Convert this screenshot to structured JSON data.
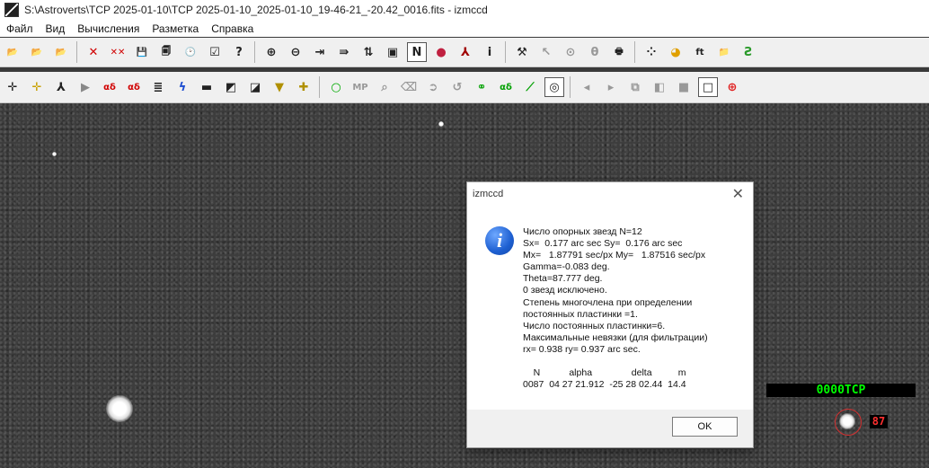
{
  "window": {
    "title": "S:\\Astroverts\\TCP 2025-01-10\\TCP 2025-01-10_2025-01-10_19-46-21_-20.42_0016.fits - izmccd"
  },
  "menu": {
    "items": [
      "Файл",
      "Вид",
      "Вычисления",
      "Разметка",
      "Справка"
    ]
  },
  "toolbar1": {
    "buttons": [
      {
        "name": "open-folder-icon",
        "glyph": "📂"
      },
      {
        "name": "open-next-icon",
        "glyph": "📂"
      },
      {
        "name": "open-multi-icon",
        "glyph": "📂"
      },
      {
        "name": "delete-icon",
        "glyph": "✕",
        "color": "#d00000"
      },
      {
        "name": "delete-all-icon",
        "glyph": "✕✕",
        "color": "#d00000"
      },
      {
        "name": "save-icon",
        "glyph": "💾"
      },
      {
        "name": "save-all-icon",
        "glyph": "🗐"
      },
      {
        "name": "clock-icon",
        "glyph": "🕑"
      },
      {
        "name": "checklist-icon",
        "glyph": "☑"
      },
      {
        "name": "help-icon",
        "glyph": "?"
      },
      {
        "name": "zoom-in-icon",
        "glyph": "⊕"
      },
      {
        "name": "zoom-out-icon",
        "glyph": "⊖"
      },
      {
        "name": "arrow-right-icon",
        "glyph": "⇥"
      },
      {
        "name": "arrow-right-alt-icon",
        "glyph": "⇛"
      },
      {
        "name": "flip-vertical-icon",
        "glyph": "⇅"
      },
      {
        "name": "display-icon",
        "glyph": "▣"
      },
      {
        "name": "north-icon",
        "glyph": "N",
        "pressed": true
      },
      {
        "name": "color-wheel-icon",
        "glyph": "●",
        "color": "#c02040"
      },
      {
        "name": "lambda-icon",
        "glyph": "⅄",
        "color": "#a00000"
      },
      {
        "name": "info-i-icon",
        "glyph": "i"
      },
      {
        "name": "hammer-icon",
        "glyph": "⚒"
      },
      {
        "name": "cursor-icon",
        "glyph": "↖",
        "color": "#999999"
      },
      {
        "name": "ellipse-icon",
        "glyph": "⊙",
        "color": "#999999"
      },
      {
        "name": "theta-icon",
        "glyph": "θ",
        "color": "#999999"
      },
      {
        "name": "print-icon",
        "glyph": "🖶"
      },
      {
        "name": "dots-icon",
        "glyph": "⁘"
      },
      {
        "name": "palette-icon",
        "glyph": "◕",
        "color": "#e0a000"
      },
      {
        "name": "ft-icon",
        "glyph": "ft"
      },
      {
        "name": "folder-open-icon",
        "glyph": "📁"
      },
      {
        "name": "spectrum-icon",
        "glyph": "Ƨ",
        "color": "#2a9a2a"
      }
    ]
  },
  "toolbar2": {
    "buttons": [
      {
        "name": "crosshair-icon",
        "glyph": "✛"
      },
      {
        "name": "crosshair-yellow-icon",
        "glyph": "✛",
        "color": "#c8a000"
      },
      {
        "name": "fork-icon",
        "glyph": "⅄"
      },
      {
        "name": "play-icon",
        "glyph": "▶",
        "color": "#888888"
      },
      {
        "name": "alpha-delta-icon",
        "glyph": "αδ",
        "color": "#d00000"
      },
      {
        "name": "alpha-delta-box-icon",
        "glyph": "αδ",
        "color": "#d00000"
      },
      {
        "name": "bars-icon",
        "glyph": "≣"
      },
      {
        "name": "lightning-icon",
        "glyph": "ϟ",
        "color": "#1a4bd0"
      },
      {
        "name": "minus-box-icon",
        "glyph": "▬"
      },
      {
        "name": "diagonal-box-icon",
        "glyph": "◩"
      },
      {
        "name": "gradient-box-icon",
        "glyph": "◪"
      },
      {
        "name": "down-box-icon",
        "glyph": "▼",
        "color": "#b09000"
      },
      {
        "name": "plus-box-icon",
        "glyph": "✚",
        "color": "#b09000"
      },
      {
        "name": "circle-green-icon",
        "glyph": "○",
        "color": "#00aa00"
      },
      {
        "name": "mp-icon",
        "glyph": "MP",
        "color": "#999999"
      },
      {
        "name": "magnifier-icon",
        "glyph": "⌕",
        "color": "#999999"
      },
      {
        "name": "eraser-icon",
        "glyph": "⌫",
        "color": "#999999"
      },
      {
        "name": "circle-arrow-right-icon",
        "glyph": "➲",
        "color": "#999999"
      },
      {
        "name": "circle-arrow-left-icon",
        "glyph": "↺",
        "color": "#999999"
      },
      {
        "name": "link-icon",
        "glyph": "⚭",
        "color": "#00a000"
      },
      {
        "name": "alpha-delta-green-icon",
        "glyph": "αδ",
        "color": "#00a000"
      },
      {
        "name": "ruler-icon",
        "glyph": "⟋",
        "color": "#00a000"
      },
      {
        "name": "ring-icon",
        "glyph": "◎",
        "pressed": true
      },
      {
        "name": "back-icon",
        "glyph": "◂",
        "color": "#999999"
      },
      {
        "name": "forward-icon",
        "glyph": "▸",
        "color": "#999999"
      },
      {
        "name": "stack-icon",
        "glyph": "⧉",
        "color": "#999999"
      },
      {
        "name": "split-icon",
        "glyph": "◧",
        "color": "#999999"
      },
      {
        "name": "gray-square-icon",
        "glyph": "■",
        "color": "#999999"
      },
      {
        "name": "black-frame-icon",
        "glyph": "□",
        "pressed": true
      },
      {
        "name": "target-icon",
        "glyph": "⊕",
        "color": "#e02020"
      }
    ]
  },
  "image": {
    "target_label": "0000TCP",
    "target_number": "87"
  },
  "dialog": {
    "title": "izmccd",
    "message": "Число опорных звезд N=12\nSx=  0.177 arc sec Sy=  0.176 arc sec\nMx=   1.87791 sec/px My=   1.87516 sec/px\nGamma=-0.083 deg.\nTheta=87.777 deg.\n0 звезд исключено.\nСтепень многочлена при определении\nпостоянных пластинки =1.\nЧисло постоянных пластинки=6.\nМаксимальные невязки (для фильтрации)\nrx= 0.938 ry= 0.937 arc sec.\n\n    N           alpha               delta          m\n0087  04 27 21.912  -25 28 02.44  14.4",
    "ok_label": "OK"
  }
}
